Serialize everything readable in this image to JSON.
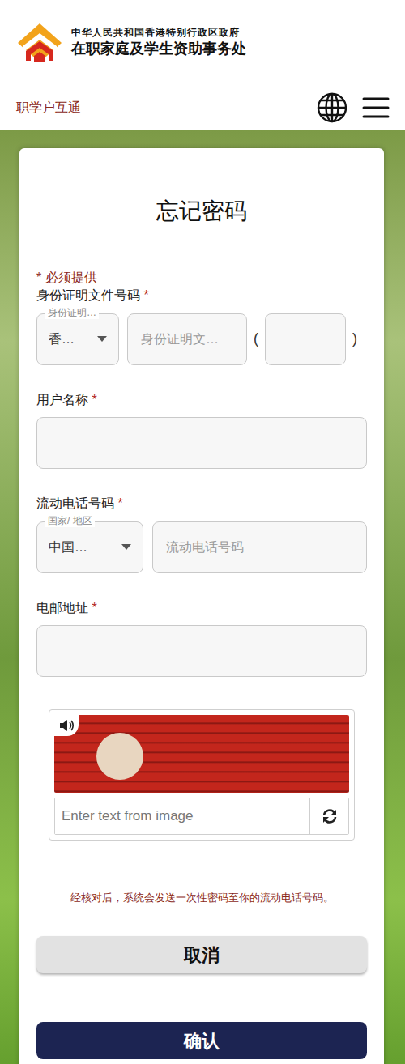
{
  "header": {
    "org_line1": "中华人民共和国香港特别行政区政府",
    "org_line2": "在职家庭及学生资助事务处"
  },
  "navbar": {
    "brand": "职学户互通"
  },
  "form": {
    "title": "忘记密码",
    "required_note": "* 必须提供",
    "id_field": {
      "label": "身份证明文件号码",
      "required": "*",
      "type_legend": "身份证明…",
      "type_value": "香…",
      "number_placeholder": "身份证明文…",
      "open_paren": "(",
      "close_paren": ")"
    },
    "username": {
      "label": "用户名称",
      "required": "*"
    },
    "mobile": {
      "label": "流动电话号码",
      "required": "*",
      "region_legend": "国家/ 地区",
      "region_value": "中国…",
      "number_placeholder": "流动电话号码"
    },
    "email": {
      "label": "电邮地址",
      "required": "*"
    },
    "captcha": {
      "placeholder": "Enter text from image"
    },
    "notice": "经核对后，系统会发送一次性密码至你的流动电话号码。",
    "buttons": [
      "取消",
      "确认"
    ]
  }
}
